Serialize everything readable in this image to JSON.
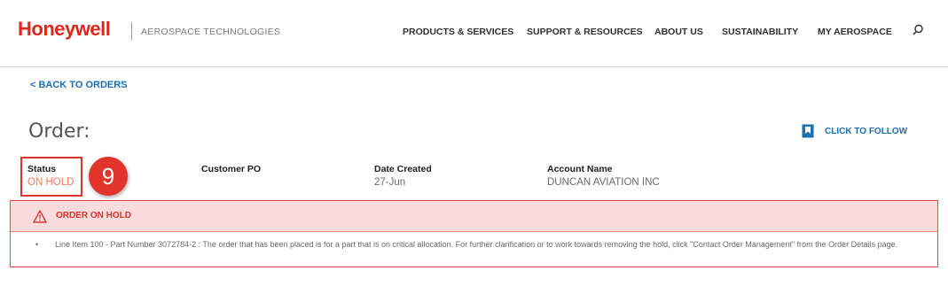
{
  "header": {
    "brand": "Honeywell",
    "brand_sub": "AEROSPACE TECHNOLOGIES",
    "nav": [
      "PRODUCTS & SERVICES",
      "SUPPORT & RESOURCES",
      "ABOUT US",
      "SUSTAINABILITY",
      "MY AEROSPACE"
    ],
    "search_icon": "search-icon"
  },
  "back_link": "< BACK TO ORDERS",
  "order_title": "Order:",
  "follow_label": "CLICK TO FOLLOW",
  "fields": {
    "status": {
      "label": "Status",
      "value": "ON HOLD"
    },
    "customer_po": {
      "label": "Customer PO",
      "value": ""
    },
    "date_created": {
      "label": "Date Created",
      "value": "27-Jun"
    },
    "account_name": {
      "label": "Account Name",
      "value": "DUNCAN AVIATION INC"
    }
  },
  "step_badge": "9",
  "alert": {
    "title": "ORDER ON HOLD",
    "bullet": "•",
    "message": "Line Item 100 - Part Number 3072784-2 : The order that has been placed is for a part that is on critical allocation. For further clarification or to work towards removing the hold, click \"Contact Order Management\" from the Order Details page."
  },
  "colors": {
    "brand_red": "#e1261c",
    "link_blue": "#1a6fb5",
    "alert_bg": "#fbdcdc",
    "status_orange": "#f07a5a"
  }
}
